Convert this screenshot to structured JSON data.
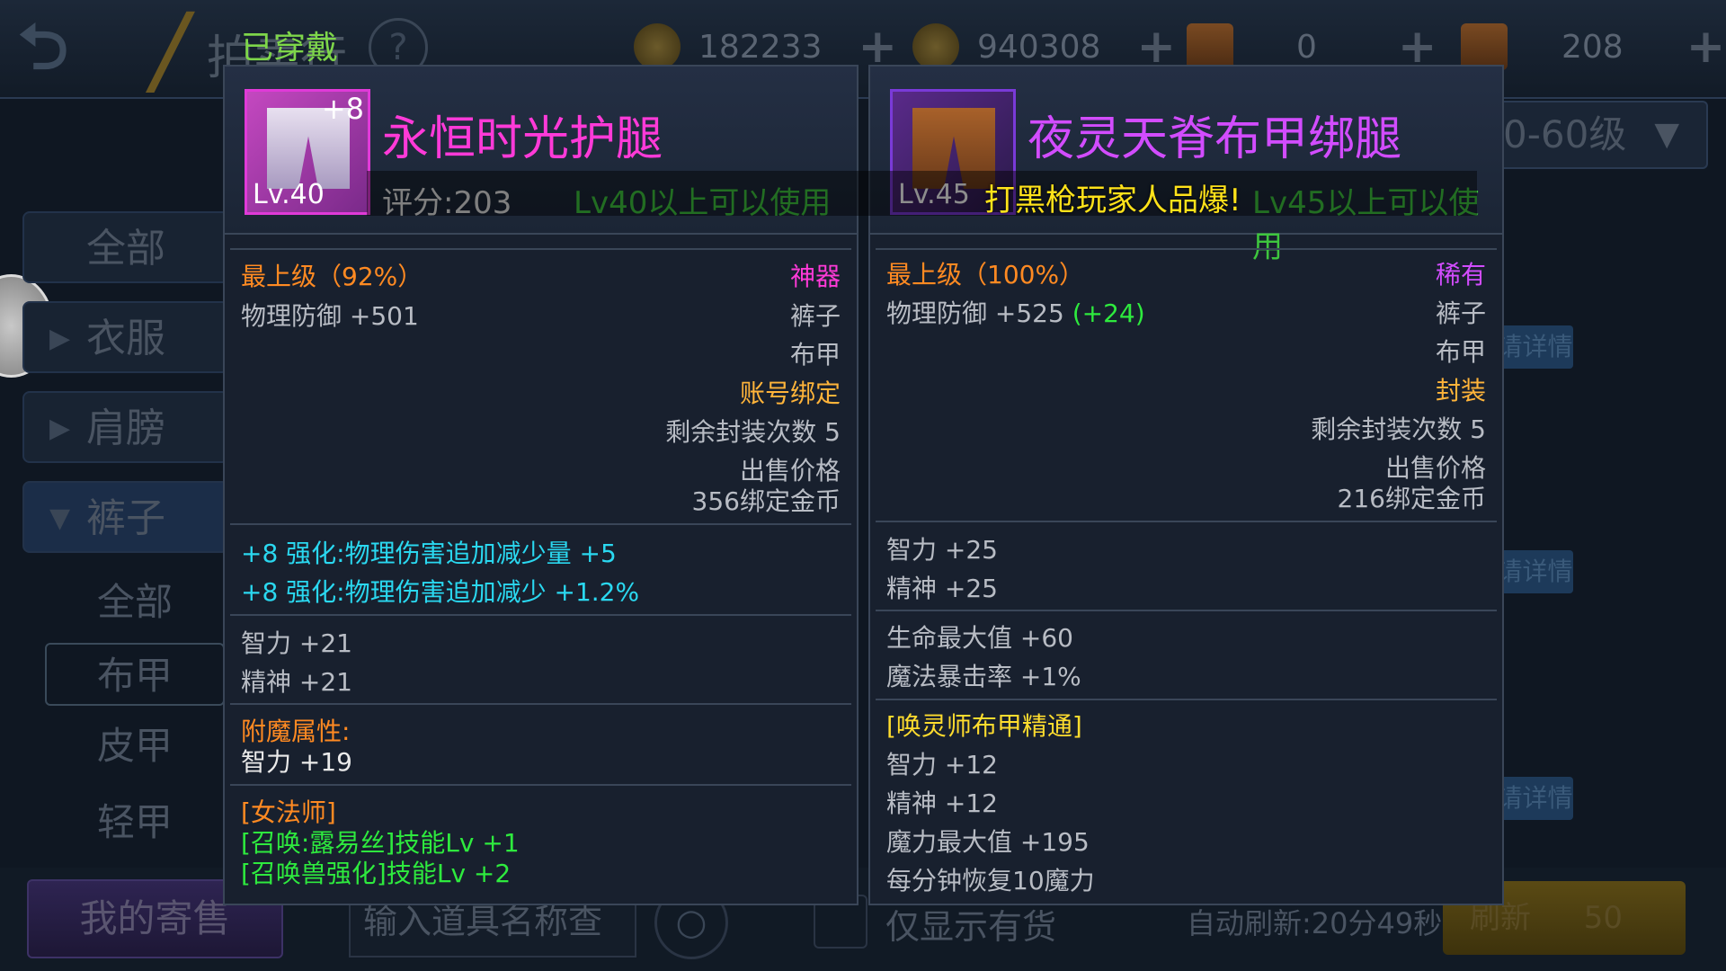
{
  "header": {
    "title": "拍卖行",
    "help": "?",
    "currencies": [
      {
        "icon": "gold-coin-icon",
        "value": "182233"
      },
      {
        "icon": "bound-coin-icon",
        "value": "940308"
      },
      {
        "icon": "scroll-icon",
        "value": "0"
      },
      {
        "icon": "scroll-icon",
        "value": "208"
      }
    ],
    "plus": "+"
  },
  "level_filter": {
    "value": "0-60级"
  },
  "sidebar": {
    "items": [
      {
        "label": "全部"
      },
      {
        "label": "衣服"
      },
      {
        "label": "肩膀"
      },
      {
        "label": "裤子"
      }
    ],
    "sub_items": [
      {
        "label": "全部"
      },
      {
        "label": "布甲"
      },
      {
        "label": "皮甲"
      },
      {
        "label": "轻甲"
      }
    ]
  },
  "list": {
    "detail_label": "请详情"
  },
  "bottom": {
    "my_sale": "我的寄售",
    "search_placeholder": "输入道具名称查找",
    "stock_only": "仅显示有货",
    "auto_refresh": "自动刷新:20分49秒",
    "refresh": "刷新",
    "refresh_cost": "50"
  },
  "worn_label": "已穿戴",
  "danmaku": "打黑枪玩家人品爆!",
  "left_item": {
    "name": "永恒时光护腿",
    "enhance": "+8",
    "level": "Lv.40",
    "score": "评分:203",
    "use_req": "Lv40以上可以使用",
    "grade": "最上级（92%）",
    "rarity": "神器",
    "stat_main": "物理防御 +501",
    "slot": "裤子",
    "armor_type": "布甲",
    "binding": "账号绑定",
    "seal_left": "剩余封装次数 5",
    "sell_label": "出售价格",
    "sell_price": "356绑定金币",
    "enh_lines": [
      "+8 强化:物理伤害追加减少量 +5",
      "+8 强化:物理伤害追加减少 +1.2%"
    ],
    "base_stats": [
      "智力 +21",
      "精神 +21"
    ],
    "enchant_label": "附魔属性:",
    "enchant_value": "智力 +19",
    "class_label": "[女法师]",
    "class_skills": [
      "[召唤:露易丝]技能Lv +1",
      "[召唤兽强化]技能Lv +2"
    ]
  },
  "right_item": {
    "name": "夜灵天脊布甲绑腿",
    "level": "Lv.45",
    "use_req": "Lv45以上可以使用",
    "grade": "最上级（100%）",
    "rarity": "稀有",
    "stat_main": "物理防御 +525",
    "stat_diff": "(+24)",
    "slot": "裤子",
    "armor_type": "布甲",
    "binding": "封装",
    "seal_left": "剩余封装次数 5",
    "sell_label": "出售价格",
    "sell_price": "216绑定金币",
    "base_stats": [
      "智力 +25",
      "精神 +25"
    ],
    "extra_stats": [
      "生命最大值 +60",
      "魔法暴击率 +1%"
    ],
    "mastery_label": "[唤灵师布甲精通]",
    "mastery_stats": [
      "智力 +12",
      "精神 +12",
      "魔力最大值 +195",
      "每分钟恢复10魔力"
    ]
  }
}
